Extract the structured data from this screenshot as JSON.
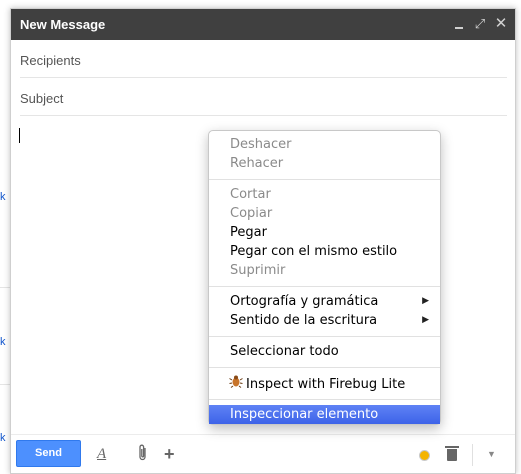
{
  "background": {
    "links": [
      "k",
      "k",
      "k"
    ]
  },
  "compose": {
    "title": "New Message",
    "titlebar_buttons": {
      "minimize": "minimize-icon",
      "popout": "popout-icon",
      "close": "close-icon"
    },
    "recipients_placeholder": "Recipients",
    "subject_placeholder": "Subject",
    "send_label": "Send",
    "toolbar_icons": [
      "text-format-icon",
      "paperclip-icon",
      "plus-icon",
      "saved-indicator-icon",
      "trash-icon",
      "chevron-down-icon"
    ]
  },
  "context_menu": {
    "items": [
      {
        "label": "Deshacer",
        "enabled": false
      },
      {
        "label": "Rehacer",
        "enabled": false
      },
      {
        "label": "Cortar",
        "enabled": false
      },
      {
        "label": "Copiar",
        "enabled": false
      },
      {
        "label": "Pegar",
        "enabled": true
      },
      {
        "label": "Pegar con el mismo estilo",
        "enabled": true
      },
      {
        "label": "Suprimir",
        "enabled": false
      },
      {
        "label": "Ortografía y gramática",
        "enabled": true,
        "submenu": true
      },
      {
        "label": "Sentido de la escritura",
        "enabled": true,
        "submenu": true
      },
      {
        "label": "Seleccionar todo",
        "enabled": true
      },
      {
        "label": "Inspect with Firebug Lite",
        "enabled": true,
        "icon": "firebug-icon"
      },
      {
        "label": "Inspeccionar elemento",
        "enabled": true,
        "highlighted": true
      }
    ],
    "highlight_color": "#3d63e8"
  },
  "colors": {
    "titlebar": "#404040",
    "send_button": "#4d90fe",
    "link": "#1155cc"
  }
}
